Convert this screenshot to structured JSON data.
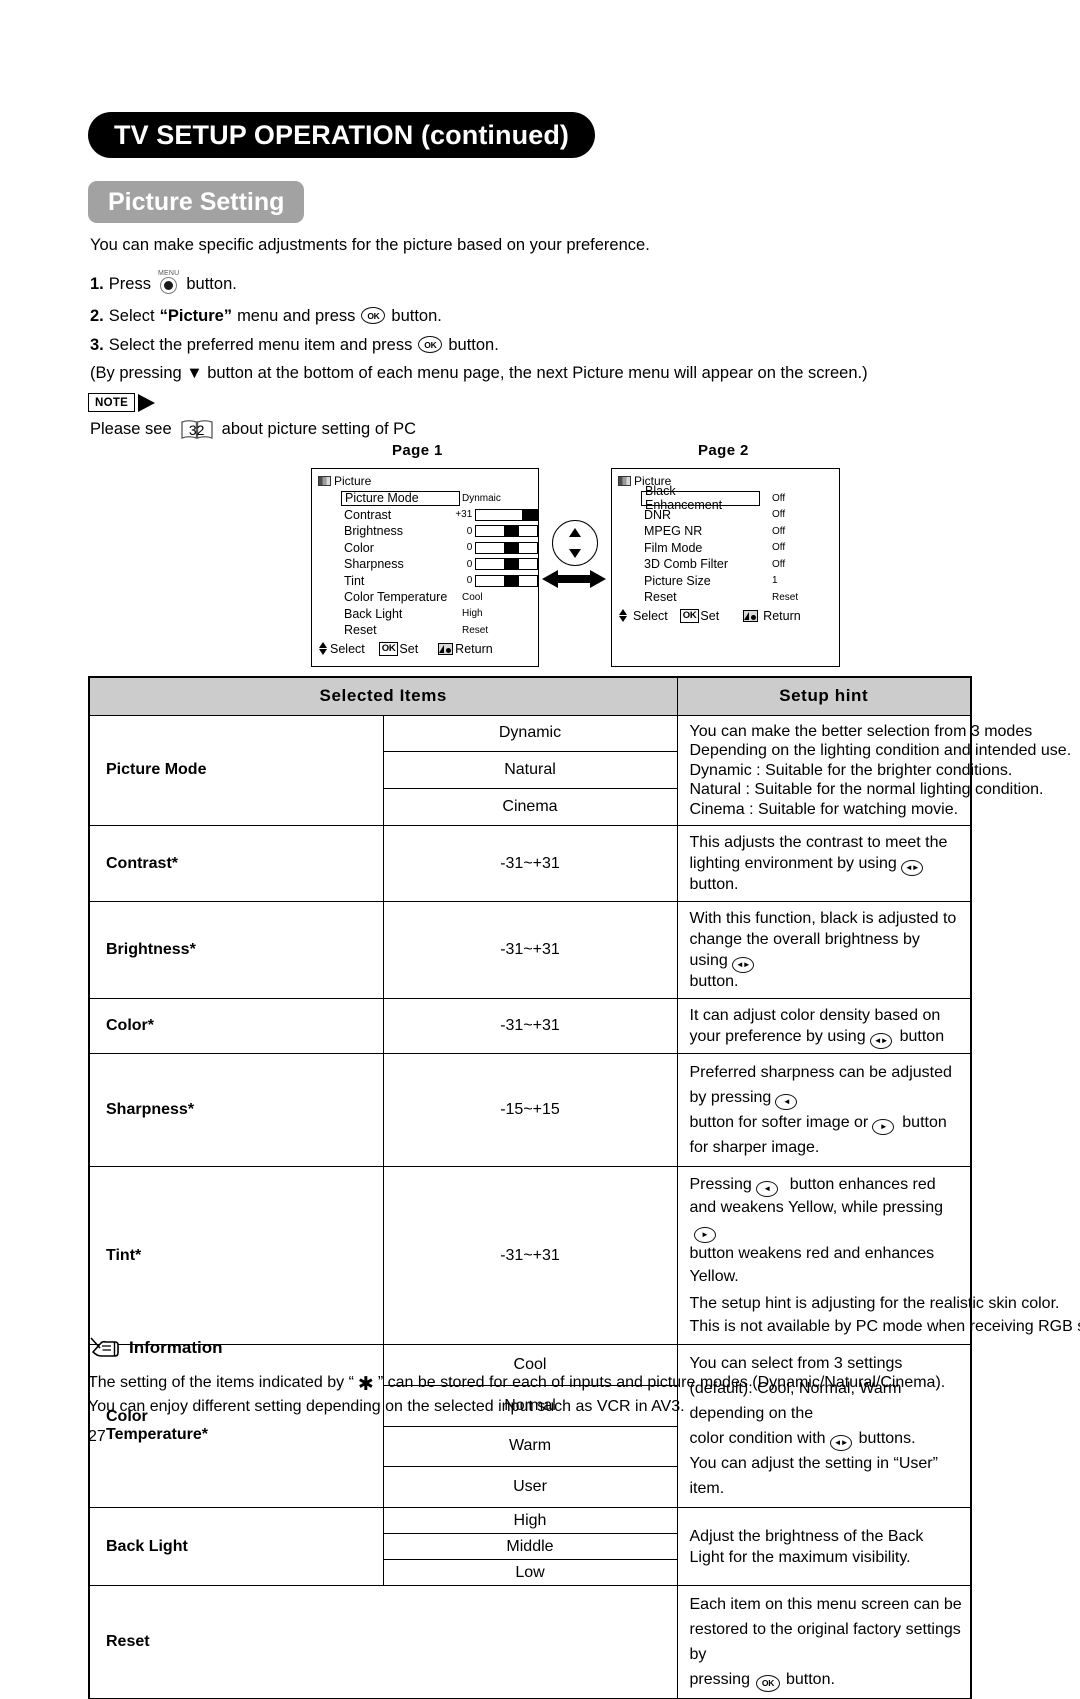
{
  "header": {
    "banner_title": "TV SETUP OPERATION (continued)",
    "section_title": "Picture Setting"
  },
  "intro": {
    "lead": "You can make specific adjustments for the picture based on your preference.",
    "steps": [
      {
        "num": "1.",
        "before": "Press",
        "icon": "menu-button-icon",
        "after": "button."
      },
      {
        "num": "2.",
        "before": "Select",
        "bold": "“Picture”",
        "mid": "menu and press",
        "icon": "ok-button-icon",
        "after": "button."
      },
      {
        "num": "3.",
        "before": "Select the preferred menu item and press",
        "icon": "ok-button-icon",
        "after": "button."
      }
    ],
    "paren_note": "(By pressing ▼ button at the bottom of each menu page, the next Picture menu will appear on the screen.)",
    "note_label": "NOTE",
    "note_text_before": "Please see",
    "note_page_ref": "32",
    "note_text_after": "about picture setting of PC"
  },
  "osd": {
    "page1": {
      "label": "Page 1",
      "title": "Picture",
      "rows": [
        {
          "name": "Picture Mode",
          "value": "Dynmaic",
          "type": "text",
          "selected": true
        },
        {
          "name": "Contrast",
          "value": "+31",
          "type": "slider",
          "thumb_pct": 100
        },
        {
          "name": "Brightness",
          "value": "0",
          "type": "slider",
          "thumb_pct": 50
        },
        {
          "name": "Color",
          "value": "0",
          "type": "slider",
          "thumb_pct": 50
        },
        {
          "name": "Sharpness",
          "value": "0",
          "type": "slider",
          "thumb_pct": 50
        },
        {
          "name": "Tint",
          "value": "0",
          "type": "slider",
          "thumb_pct": 50
        },
        {
          "name": "Color Temperature",
          "value": "Cool",
          "type": "text"
        },
        {
          "name": "Back Light",
          "value": "High",
          "type": "text"
        },
        {
          "name": "Reset",
          "value": "Reset",
          "type": "text"
        }
      ],
      "nav": {
        "select": "Select",
        "ok": "OK",
        "set": "Set",
        "return": "Return"
      }
    },
    "page2": {
      "label": "Page 2",
      "title": "Picture",
      "rows": [
        {
          "name": "Black Enhancement",
          "value": "Off",
          "selected": true
        },
        {
          "name": "DNR",
          "value": "Off"
        },
        {
          "name": "MPEG NR",
          "value": "Off"
        },
        {
          "name": "Film Mode",
          "value": "Off"
        },
        {
          "name": "3D Comb Filter",
          "value": "Off"
        },
        {
          "name": "Picture Size",
          "value": "1"
        },
        {
          "name": "Reset",
          "value": "Reset"
        }
      ],
      "nav": {
        "select": "Select",
        "ok": "OK",
        "set": "Set",
        "return": "Return"
      }
    }
  },
  "table": {
    "headers": {
      "col1": "Selected Items",
      "col2": "Setup hint"
    },
    "rows": {
      "picture_mode": {
        "item": "Picture Mode",
        "options": [
          "Dynamic",
          "Natural",
          "Cinema"
        ],
        "hint": [
          "You can make the better selection from 3 modes",
          "Depending on the lighting condition and intended use.",
          "Dynamic : Suitable for the brighter conditions.",
          "Natural   : Suitable for the normal lighting condition.",
          "Cinema  : Suitable for watching movie."
        ]
      },
      "contrast": {
        "item": "Contrast*",
        "range": "-31~+31",
        "hint_a": "This adjusts the contrast to meet the lighting environment by using",
        "hint_b": "button."
      },
      "brightness": {
        "item": "Brightness*",
        "range": "-31~+31",
        "hint_a": "With this function, black is adjusted to change the overall brightness by using",
        "hint_b": "button."
      },
      "color": {
        "item": "Color*",
        "range": "-31~+31",
        "hint_a": "It can adjust color density based on your preference by using",
        "hint_b": "button"
      },
      "sharpness": {
        "item": "Sharpness*",
        "range": "-15~+15",
        "hint_a": "Preferred sharpness can be adjusted by pressing",
        "hint_b": "button for softer image or",
        "hint_c": "button for sharper image."
      },
      "tint": {
        "item": "Tint*",
        "range": "-31~+31",
        "hint_a": "Pressing",
        "hint_b": "button enhances red and weakens Yellow, while pressing",
        "hint_c": "button weakens red and enhances Yellow.",
        "hint_d": "The setup hint is adjusting for the realistic skin color.",
        "hint_e": "This is not available by PC mode when receiving RGB signal."
      },
      "color_temperature": {
        "item_line1": "Color",
        "item_line2": "Temperature*",
        "options": [
          "Cool",
          "Normal",
          "Warm",
          "User"
        ],
        "hint_a": "You can select from 3 settings (default): Cool, Normal, Warm depending on the",
        "hint_b": "color condition with",
        "hint_c": "buttons.",
        "hint_d": "You can adjust the setting in “User” item."
      },
      "back_light": {
        "item": "Back Light",
        "options": [
          "High",
          "Middle",
          "Low"
        ],
        "hint": "Adjust the brightness of the Back Light for the maximum visibility."
      },
      "reset": {
        "item": "Reset",
        "hint_a": "Each item on this menu screen can be restored to the original factory settings by",
        "hint_b": "pressing",
        "hint_c": "button."
      }
    }
  },
  "information": {
    "heading": "Information",
    "line1_a": "The setting of the items indicated by “",
    "star": "✱",
    "line1_b": "” can be stored for each of inputs and picture modes (Dynamic/Natural/Cinema).",
    "line2": "You can enjoy different setting depending on the selected input such as VCR in AV3.",
    "page_number": "27"
  },
  "colors": {
    "banner_bg": "#000000",
    "section_bg": "#a2a2a2",
    "table_header_bg": "#cccccc"
  }
}
